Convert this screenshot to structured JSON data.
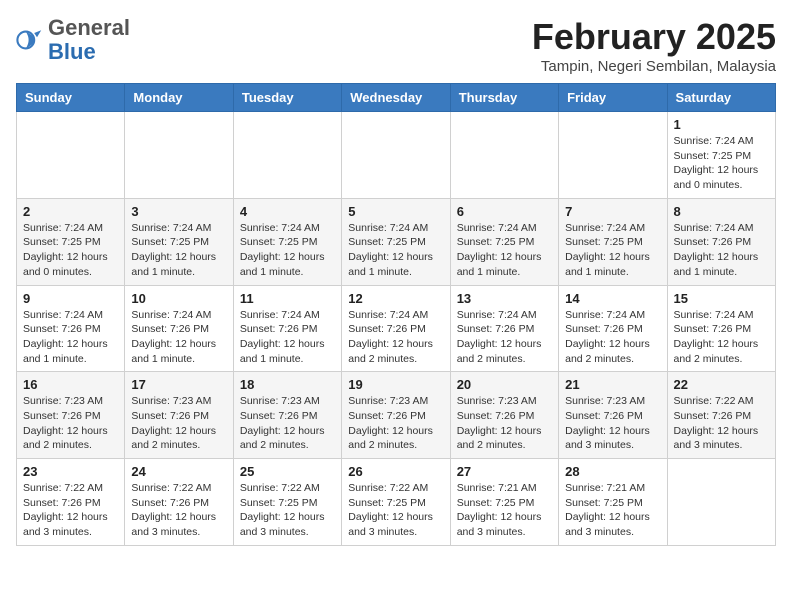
{
  "logo": {
    "general": "General",
    "blue": "Blue"
  },
  "title": {
    "month": "February 2025",
    "location": "Tampin, Negeri Sembilan, Malaysia"
  },
  "days_of_week": [
    "Sunday",
    "Monday",
    "Tuesday",
    "Wednesday",
    "Thursday",
    "Friday",
    "Saturday"
  ],
  "weeks": [
    [
      {
        "day": "",
        "info": ""
      },
      {
        "day": "",
        "info": ""
      },
      {
        "day": "",
        "info": ""
      },
      {
        "day": "",
        "info": ""
      },
      {
        "day": "",
        "info": ""
      },
      {
        "day": "",
        "info": ""
      },
      {
        "day": "1",
        "info": "Sunrise: 7:24 AM\nSunset: 7:25 PM\nDaylight: 12 hours\nand 0 minutes."
      }
    ],
    [
      {
        "day": "2",
        "info": "Sunrise: 7:24 AM\nSunset: 7:25 PM\nDaylight: 12 hours\nand 0 minutes."
      },
      {
        "day": "3",
        "info": "Sunrise: 7:24 AM\nSunset: 7:25 PM\nDaylight: 12 hours\nand 1 minute."
      },
      {
        "day": "4",
        "info": "Sunrise: 7:24 AM\nSunset: 7:25 PM\nDaylight: 12 hours\nand 1 minute."
      },
      {
        "day": "5",
        "info": "Sunrise: 7:24 AM\nSunset: 7:25 PM\nDaylight: 12 hours\nand 1 minute."
      },
      {
        "day": "6",
        "info": "Sunrise: 7:24 AM\nSunset: 7:25 PM\nDaylight: 12 hours\nand 1 minute."
      },
      {
        "day": "7",
        "info": "Sunrise: 7:24 AM\nSunset: 7:25 PM\nDaylight: 12 hours\nand 1 minute."
      },
      {
        "day": "8",
        "info": "Sunrise: 7:24 AM\nSunset: 7:26 PM\nDaylight: 12 hours\nand 1 minute."
      }
    ],
    [
      {
        "day": "9",
        "info": "Sunrise: 7:24 AM\nSunset: 7:26 PM\nDaylight: 12 hours\nand 1 minute."
      },
      {
        "day": "10",
        "info": "Sunrise: 7:24 AM\nSunset: 7:26 PM\nDaylight: 12 hours\nand 1 minute."
      },
      {
        "day": "11",
        "info": "Sunrise: 7:24 AM\nSunset: 7:26 PM\nDaylight: 12 hours\nand 1 minute."
      },
      {
        "day": "12",
        "info": "Sunrise: 7:24 AM\nSunset: 7:26 PM\nDaylight: 12 hours\nand 2 minutes."
      },
      {
        "day": "13",
        "info": "Sunrise: 7:24 AM\nSunset: 7:26 PM\nDaylight: 12 hours\nand 2 minutes."
      },
      {
        "day": "14",
        "info": "Sunrise: 7:24 AM\nSunset: 7:26 PM\nDaylight: 12 hours\nand 2 minutes."
      },
      {
        "day": "15",
        "info": "Sunrise: 7:24 AM\nSunset: 7:26 PM\nDaylight: 12 hours\nand 2 minutes."
      }
    ],
    [
      {
        "day": "16",
        "info": "Sunrise: 7:23 AM\nSunset: 7:26 PM\nDaylight: 12 hours\nand 2 minutes."
      },
      {
        "day": "17",
        "info": "Sunrise: 7:23 AM\nSunset: 7:26 PM\nDaylight: 12 hours\nand 2 minutes."
      },
      {
        "day": "18",
        "info": "Sunrise: 7:23 AM\nSunset: 7:26 PM\nDaylight: 12 hours\nand 2 minutes."
      },
      {
        "day": "19",
        "info": "Sunrise: 7:23 AM\nSunset: 7:26 PM\nDaylight: 12 hours\nand 2 minutes."
      },
      {
        "day": "20",
        "info": "Sunrise: 7:23 AM\nSunset: 7:26 PM\nDaylight: 12 hours\nand 2 minutes."
      },
      {
        "day": "21",
        "info": "Sunrise: 7:23 AM\nSunset: 7:26 PM\nDaylight: 12 hours\nand 3 minutes."
      },
      {
        "day": "22",
        "info": "Sunrise: 7:22 AM\nSunset: 7:26 PM\nDaylight: 12 hours\nand 3 minutes."
      }
    ],
    [
      {
        "day": "23",
        "info": "Sunrise: 7:22 AM\nSunset: 7:26 PM\nDaylight: 12 hours\nand 3 minutes."
      },
      {
        "day": "24",
        "info": "Sunrise: 7:22 AM\nSunset: 7:26 PM\nDaylight: 12 hours\nand 3 minutes."
      },
      {
        "day": "25",
        "info": "Sunrise: 7:22 AM\nSunset: 7:25 PM\nDaylight: 12 hours\nand 3 minutes."
      },
      {
        "day": "26",
        "info": "Sunrise: 7:22 AM\nSunset: 7:25 PM\nDaylight: 12 hours\nand 3 minutes."
      },
      {
        "day": "27",
        "info": "Sunrise: 7:21 AM\nSunset: 7:25 PM\nDaylight: 12 hours\nand 3 minutes."
      },
      {
        "day": "28",
        "info": "Sunrise: 7:21 AM\nSunset: 7:25 PM\nDaylight: 12 hours\nand 3 minutes."
      },
      {
        "day": "",
        "info": ""
      }
    ]
  ]
}
